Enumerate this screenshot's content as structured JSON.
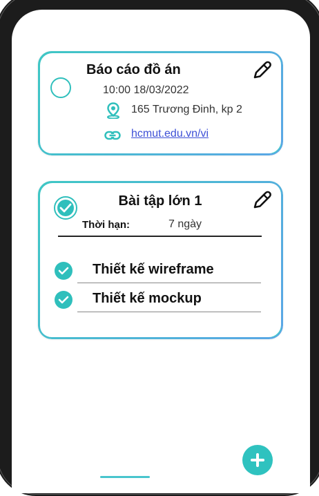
{
  "cards": [
    {
      "title": "Báo cáo đồ án",
      "datetime": "10:00 18/03/2022",
      "location": "165 Trương Đinh, kp 2",
      "link": "hcmut.edu.vn/vi",
      "completed": false,
      "icons": [
        "circle-checkbox-icon",
        "location-pin-icon",
        "link-icon",
        "pencil-icon"
      ]
    },
    {
      "title": "Bài tập lớn 1",
      "deadline_label": "Thời hạn:",
      "deadline_value": "7 ngày",
      "completed": true,
      "subtasks": [
        {
          "label": "Thiết kế wireframe",
          "done": true
        },
        {
          "label": "Thiết kế mockup",
          "done": true
        }
      ],
      "icons": [
        "check-circle-icon",
        "pencil-icon"
      ]
    }
  ],
  "fab": {
    "icon": "plus-icon"
  },
  "colors": {
    "accent": "#2fbfbc",
    "link": "#3d4fd6",
    "border_gradient_start": "#3ec7c4",
    "border_gradient_end": "#5aa6e6"
  }
}
